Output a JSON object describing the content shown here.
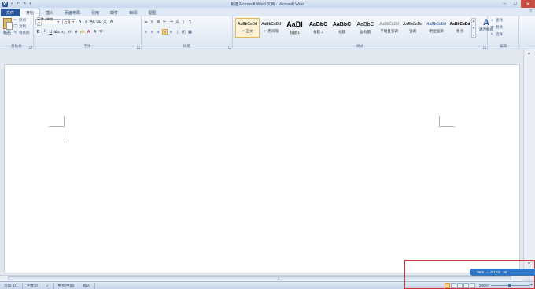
{
  "titlebar": {
    "title": "新建 Microsoft Word 文档 - Microsoft Word",
    "app_icon": "W",
    "window_controls": [
      "minimize-icon",
      "maximize-icon",
      "close-icon"
    ]
  },
  "tabs": {
    "file": "文件",
    "items": [
      "开始",
      "插入",
      "页面布局",
      "引用",
      "邮件",
      "审阅",
      "视图"
    ],
    "active_index": 0
  },
  "clipboard": {
    "paste": "粘贴",
    "cut": "剪切",
    "copy": "复制",
    "format_painter": "格式刷",
    "label": "剪贴板"
  },
  "font": {
    "name": "宋体 (中文正)",
    "size": "五号",
    "label": "字体"
  },
  "paragraph": {
    "label": "段落"
  },
  "styles": {
    "label": "样式",
    "items": [
      {
        "sample": "AaBbCcDd",
        "name": "↵ 正文",
        "active": true
      },
      {
        "sample": "AaBbCcDd",
        "name": "↵ 无间隔",
        "active": false
      },
      {
        "sample": "AaBl",
        "name": "标题 1",
        "active": false
      },
      {
        "sample": "AaBbC",
        "name": "标题 2",
        "active": false
      },
      {
        "sample": "AaBbC",
        "name": "标题",
        "active": false
      },
      {
        "sample": "AaBbC",
        "name": "副标题",
        "active": false
      },
      {
        "sample": "AaBbCcDd",
        "name": "不明显强调",
        "active": false
      },
      {
        "sample": "AaBbCcDd",
        "name": "强调",
        "active": false
      },
      {
        "sample": "AaBbCcDd",
        "name": "明显强调",
        "active": false
      },
      {
        "sample": "AaBbCcDd",
        "name": "要点",
        "active": false
      }
    ],
    "change_styles": "更改样式"
  },
  "editing": {
    "label": "编辑",
    "find": "查找",
    "replace": "替换",
    "select": "选择"
  },
  "statusbar": {
    "page": "页面: 1/1",
    "words": "字数: 0",
    "language": "中文(中国)",
    "mode": "插入",
    "zoom": "200%"
  },
  "net_widget": {
    "download": "0K/s",
    "upload": "0.1K/s",
    "percent": "45"
  },
  "colors": {
    "accent": "#2b579a",
    "status_bar": "#c6d5ea",
    "net_widget": "#2f76c7",
    "highlight_box": "#c9343b"
  }
}
